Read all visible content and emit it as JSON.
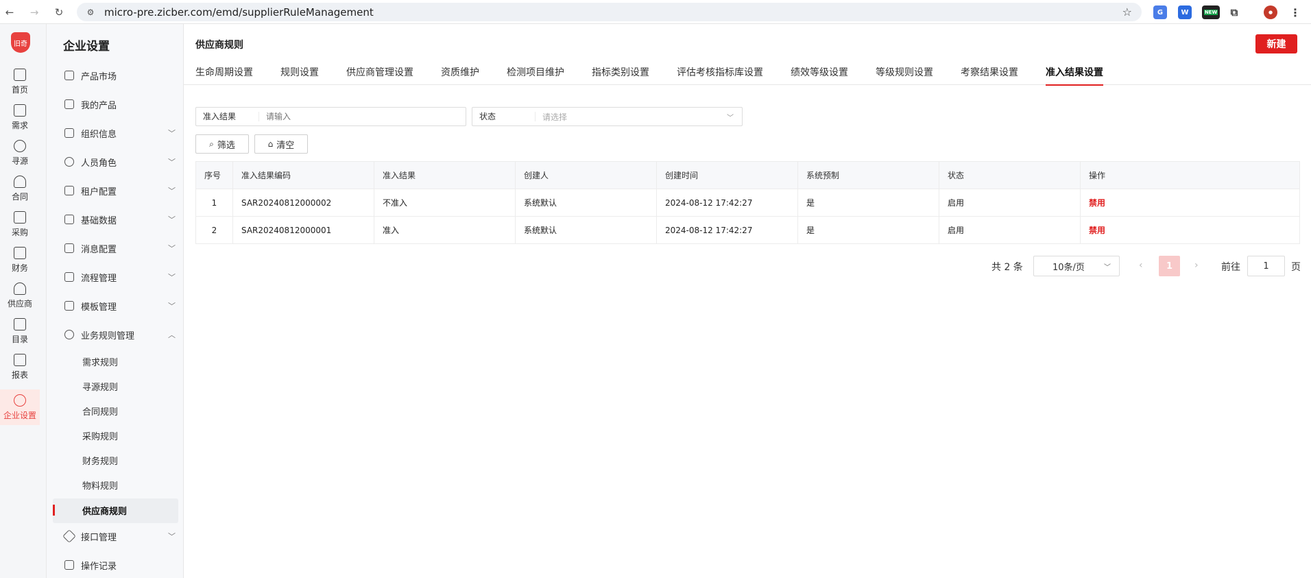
{
  "browser": {
    "url": "micro-pre.zicber.com/emd/supplierRuleManagement",
    "ext_new_badge": "NEW"
  },
  "rail": {
    "logo": "旧奇",
    "items": [
      {
        "label": "首页",
        "icon": "monitor-icon"
      },
      {
        "label": "需求",
        "icon": "clipboard-icon"
      },
      {
        "label": "寻源",
        "icon": "search-icon"
      },
      {
        "label": "合同",
        "icon": "person-icon"
      },
      {
        "label": "采购",
        "icon": "cart-icon"
      },
      {
        "label": "财务",
        "icon": "wallet-icon"
      },
      {
        "label": "供应商",
        "icon": "supplier-icon"
      },
      {
        "label": "目录",
        "icon": "book-icon"
      },
      {
        "label": "报表",
        "icon": "report-icon"
      },
      {
        "label": "企业设置",
        "icon": "settings-icon"
      }
    ]
  },
  "sidebar": {
    "title": "企业设置",
    "items": [
      {
        "label": "产品市场"
      },
      {
        "label": "我的产品"
      },
      {
        "label": "组织信息"
      },
      {
        "label": "人员角色"
      },
      {
        "label": "租户配置"
      },
      {
        "label": "基础数据"
      },
      {
        "label": "消息配置"
      },
      {
        "label": "流程管理"
      },
      {
        "label": "模板管理"
      },
      {
        "label": "业务规则管理"
      },
      {
        "label": "接口管理"
      },
      {
        "label": "操作记录"
      }
    ],
    "sub_items": [
      {
        "label": "需求规则"
      },
      {
        "label": "寻源规则"
      },
      {
        "label": "合同规则"
      },
      {
        "label": "采购规则"
      },
      {
        "label": "财务规则"
      },
      {
        "label": "物料规则"
      },
      {
        "label": "供应商规则"
      }
    ]
  },
  "page": {
    "title": "供应商规则",
    "new_button": "新建"
  },
  "tabs": [
    {
      "label": "生命周期设置"
    },
    {
      "label": "规则设置"
    },
    {
      "label": "供应商管理设置"
    },
    {
      "label": "资质维护"
    },
    {
      "label": "检测项目维护"
    },
    {
      "label": "指标类别设置"
    },
    {
      "label": "评估考核指标库设置"
    },
    {
      "label": "绩效等级设置"
    },
    {
      "label": "等级规则设置"
    },
    {
      "label": "考察结果设置"
    },
    {
      "label": "准入结果设置"
    }
  ],
  "filters": {
    "result_label": "准入结果",
    "result_placeholder": "请输入",
    "status_label": "状态",
    "status_placeholder": "请选择",
    "filter_button": "筛选",
    "clear_button": "清空"
  },
  "table": {
    "headers": [
      "序号",
      "准入结果编码",
      "准入结果",
      "创建人",
      "创建时间",
      "系统预制",
      "状态",
      "操作"
    ],
    "rows": [
      [
        "1",
        "SAR20240812000002",
        "不准入",
        "系统默认",
        "2024-08-12 17:42:27",
        "是",
        "启用",
        "禁用"
      ],
      [
        "2",
        "SAR20240812000001",
        "准入",
        "系统默认",
        "2024-08-12 17:42:27",
        "是",
        "启用",
        "禁用"
      ]
    ]
  },
  "pagination": {
    "total": "共 2 条",
    "page_size": "10条/页",
    "prev": "‹",
    "current": "1",
    "next": "›",
    "goto_label": "前往",
    "goto_value": "1",
    "page_label": "页"
  },
  "colors": {
    "accent": "#e02020",
    "active_bg": "#fde9e6"
  }
}
